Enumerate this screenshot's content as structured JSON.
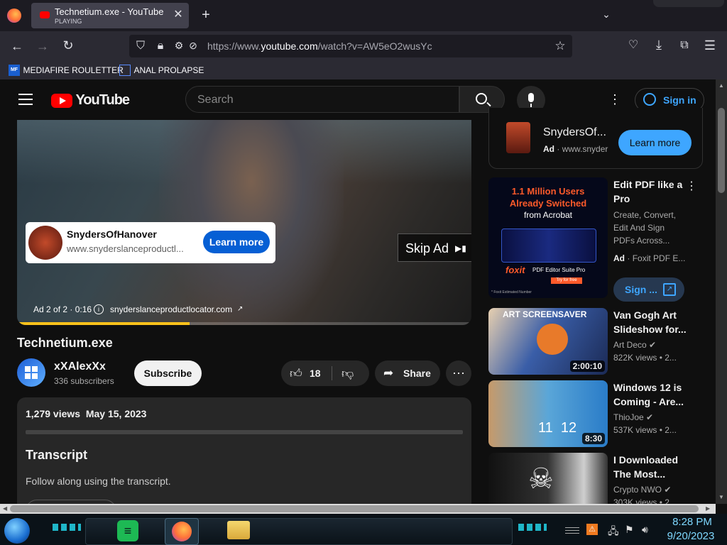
{
  "browser": {
    "tab": {
      "title": "Technetium.exe - YouTube",
      "status": "PLAYING"
    },
    "url": {
      "prefix": "https://www.",
      "domain": "youtube.com",
      "path": "/watch?v=AW5eO2wusYc"
    },
    "bookmarks": [
      {
        "label": "MEDIAFIRE ROULETTER",
        "icon_text": "MF"
      },
      {
        "label": "ANAL PROLAPSE"
      }
    ]
  },
  "youtube": {
    "logo_text": "YouTube",
    "search_placeholder": "Search",
    "sign_in": "Sign in",
    "player": {
      "ad_card": {
        "name": "SnydersOfHanover",
        "url": "www.snyderslanceproductl...",
        "cta": "Learn more"
      },
      "skip": "Skip Ad",
      "ad_counter": "Ad 2 of 2 · 0:16",
      "ad_link": "snyderslanceproductlocator.com",
      "progress": 0.38
    },
    "video": {
      "title": "Technetium.exe",
      "channel": "xXAlexXx",
      "subscribers": "336 subscribers",
      "subscribe": "Subscribe",
      "likes": "18",
      "share": "Share"
    },
    "description": {
      "views": "1,279 views",
      "date": "May 15, 2023",
      "transcript_title": "Transcript",
      "transcript_text": "Follow along using the transcript."
    },
    "sidebar_ad": {
      "name": "SnydersOf...",
      "ad_label": "Ad",
      "domain": "www.snyder",
      "cta": "Learn more"
    },
    "promo": {
      "title": "Edit PDF like a Pro",
      "desc": "Create, Convert, Edit And Sign PDFs Across...",
      "ad_label": "Ad",
      "advertiser": "Foxit PDF E...",
      "cta": "Sign ...",
      "thumb_line1": "1.1 Million Users",
      "thumb_line2": "Already Switched",
      "thumb_line3": "from Acrobat",
      "thumb_brand": "foxit",
      "thumb_product": "PDF Editor Suite Pro",
      "thumb_try": "Try for free",
      "thumb_note": "* Foxit Estimated Number"
    },
    "recommendations": [
      {
        "title": "Van Gogh Art Slideshow for...",
        "channel": "Art Deco",
        "views": "822K views",
        "age": "2...",
        "duration": "2:00:10",
        "thumb_text": "ART SCREENSAVER"
      },
      {
        "title": "Windows 12 is Coming - Are...",
        "channel": "ThioJoe",
        "views": "537K views",
        "age": "2...",
        "duration": "8:30",
        "thumb_text": "11  12"
      },
      {
        "title": "I Downloaded The Most...",
        "channel": "Crypto NWO",
        "views": "303K views",
        "age": "2...",
        "duration": "",
        "thumb_text": ""
      }
    ]
  },
  "taskbar": {
    "time": "8:28 PM",
    "date": "9/20/2023"
  },
  "colors": {
    "youtube_red": "#ff0000",
    "link_blue": "#3ea6ff",
    "ad_blue": "#065fd4",
    "firefox_orange": "#ff7139"
  }
}
